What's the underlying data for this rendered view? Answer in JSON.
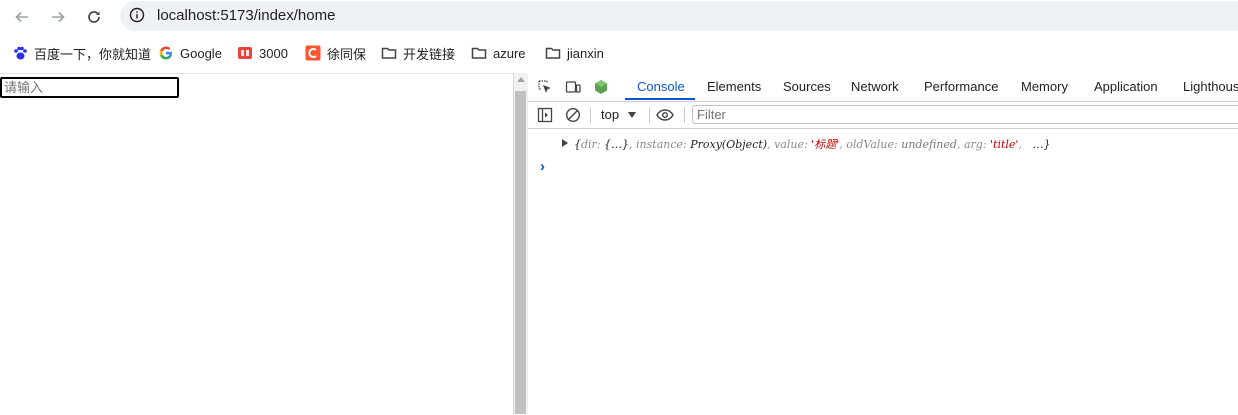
{
  "browser": {
    "url": "localhost:5173/index/home",
    "nav": {
      "back_icon": "arrow-left-icon",
      "forward_icon": "arrow-right-icon",
      "reload_icon": "reload-icon"
    }
  },
  "bookmarks": [
    {
      "label": "百度一下，你就知道",
      "icon": "baidu-paw-icon"
    },
    {
      "label": "Google",
      "icon": "google-g-icon"
    },
    {
      "label": "3000",
      "icon": "book-icon"
    },
    {
      "label": "徐同保",
      "icon": "csdn-c-icon"
    },
    {
      "label": "开发链接",
      "icon": "folder-icon"
    },
    {
      "label": "azure",
      "icon": "folder-icon"
    },
    {
      "label": "jianxin",
      "icon": "folder-icon"
    }
  ],
  "page": {
    "input_placeholder": "请输入"
  },
  "devtools": {
    "tabs": [
      "Console",
      "Elements",
      "Sources",
      "Network",
      "Performance",
      "Memory",
      "Application",
      "Lighthous"
    ],
    "active_tab": "Console",
    "context": "top",
    "filter_placeholder": "Filter",
    "log": {
      "open": "{",
      "dir_key": "dir",
      "dir_val": "{…}",
      "instance_key": "instance",
      "instance_val": "Proxy(Object)",
      "value_key": "value",
      "value_val": "'标题'",
      "oldValue_key": "oldValue",
      "oldValue_val": "undefined",
      "arg_key": "arg",
      "arg_val": "'title'",
      "ellipsis": "…}"
    },
    "prompt": "›"
  },
  "colors": {
    "accent": "#0b57d0",
    "string": "#c80000",
    "omnibox_bg": "#eef1f6"
  }
}
